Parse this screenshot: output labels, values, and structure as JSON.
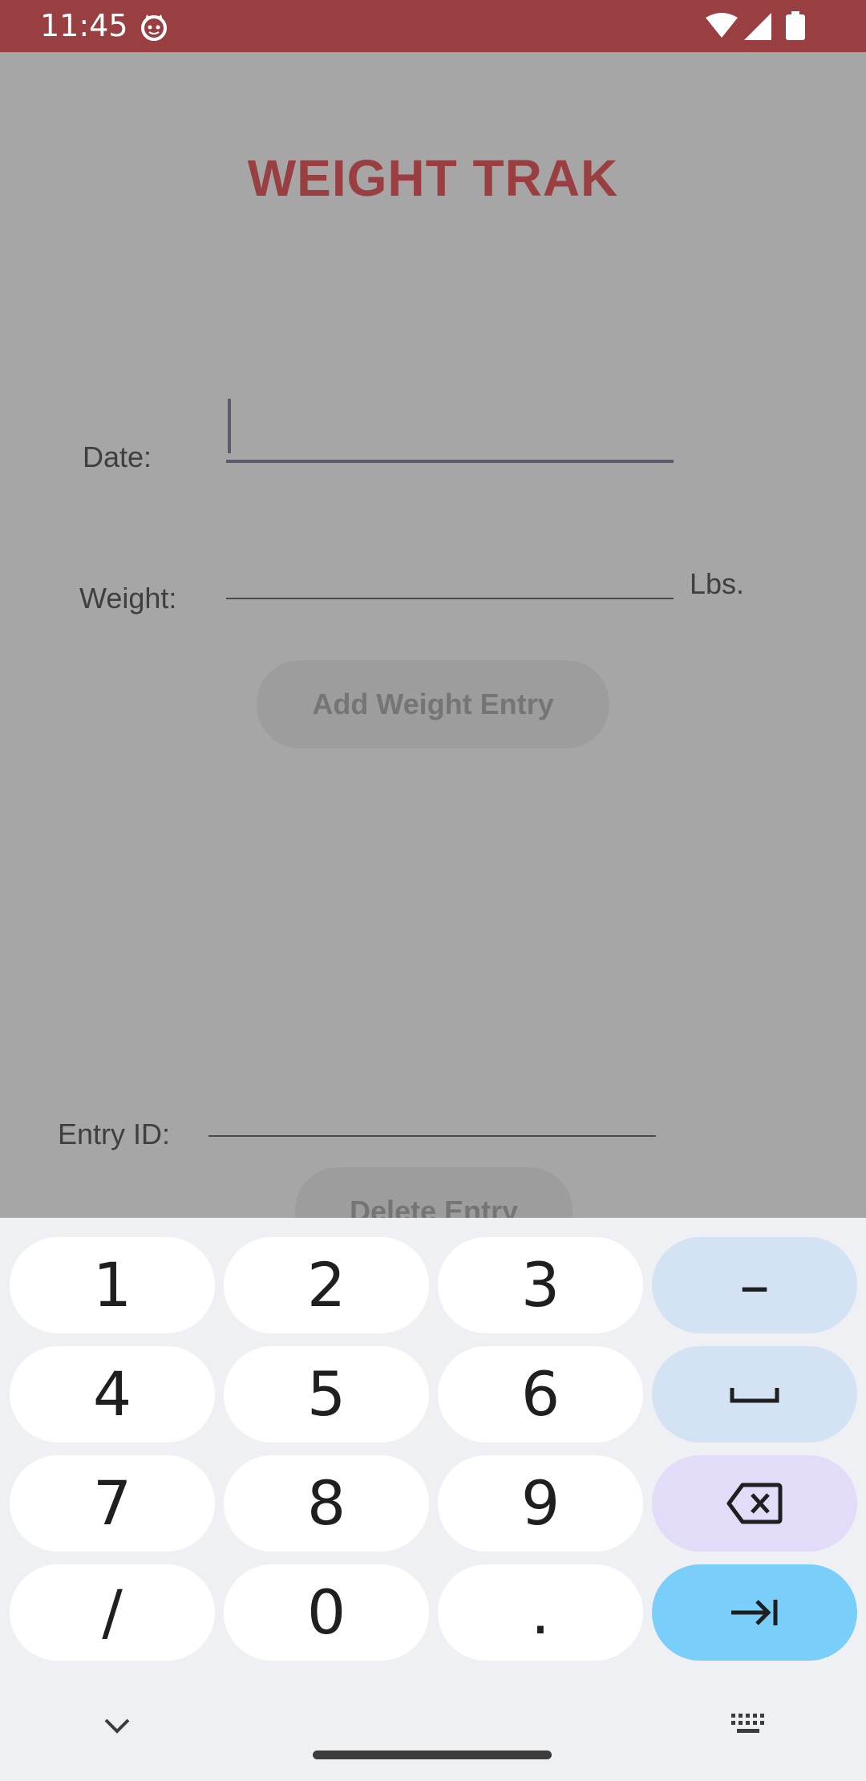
{
  "status_bar": {
    "time": "11:45",
    "icons": [
      "cat-notification-icon",
      "wifi-icon",
      "signal-icon",
      "battery-icon"
    ]
  },
  "app": {
    "title": "WEIGHT TRAK",
    "title_color": "#993f42",
    "date_label": "Date:",
    "date_value": "",
    "weight_label": "Weight:",
    "weight_value": "",
    "unit_label": "Lbs.",
    "add_button": "Add Weight Entry",
    "entry_id_label": "Entry ID:",
    "entry_id_value": "",
    "delete_button": "Delete Entry"
  },
  "keyboard": {
    "keys": [
      "1",
      "2",
      "3",
      "–",
      "4",
      "5",
      "6",
      "7",
      "8",
      "9",
      "/",
      "0",
      "."
    ],
    "special_keys": [
      "space-key-icon",
      "backspace-icon",
      "tab-next-icon",
      "chevron-down-icon",
      "keyboard-switch-icon"
    ],
    "colors": {
      "function_key": "#d3e3f4",
      "delete_key": "#e2dcf8",
      "enter_key": "#79cefa"
    }
  }
}
